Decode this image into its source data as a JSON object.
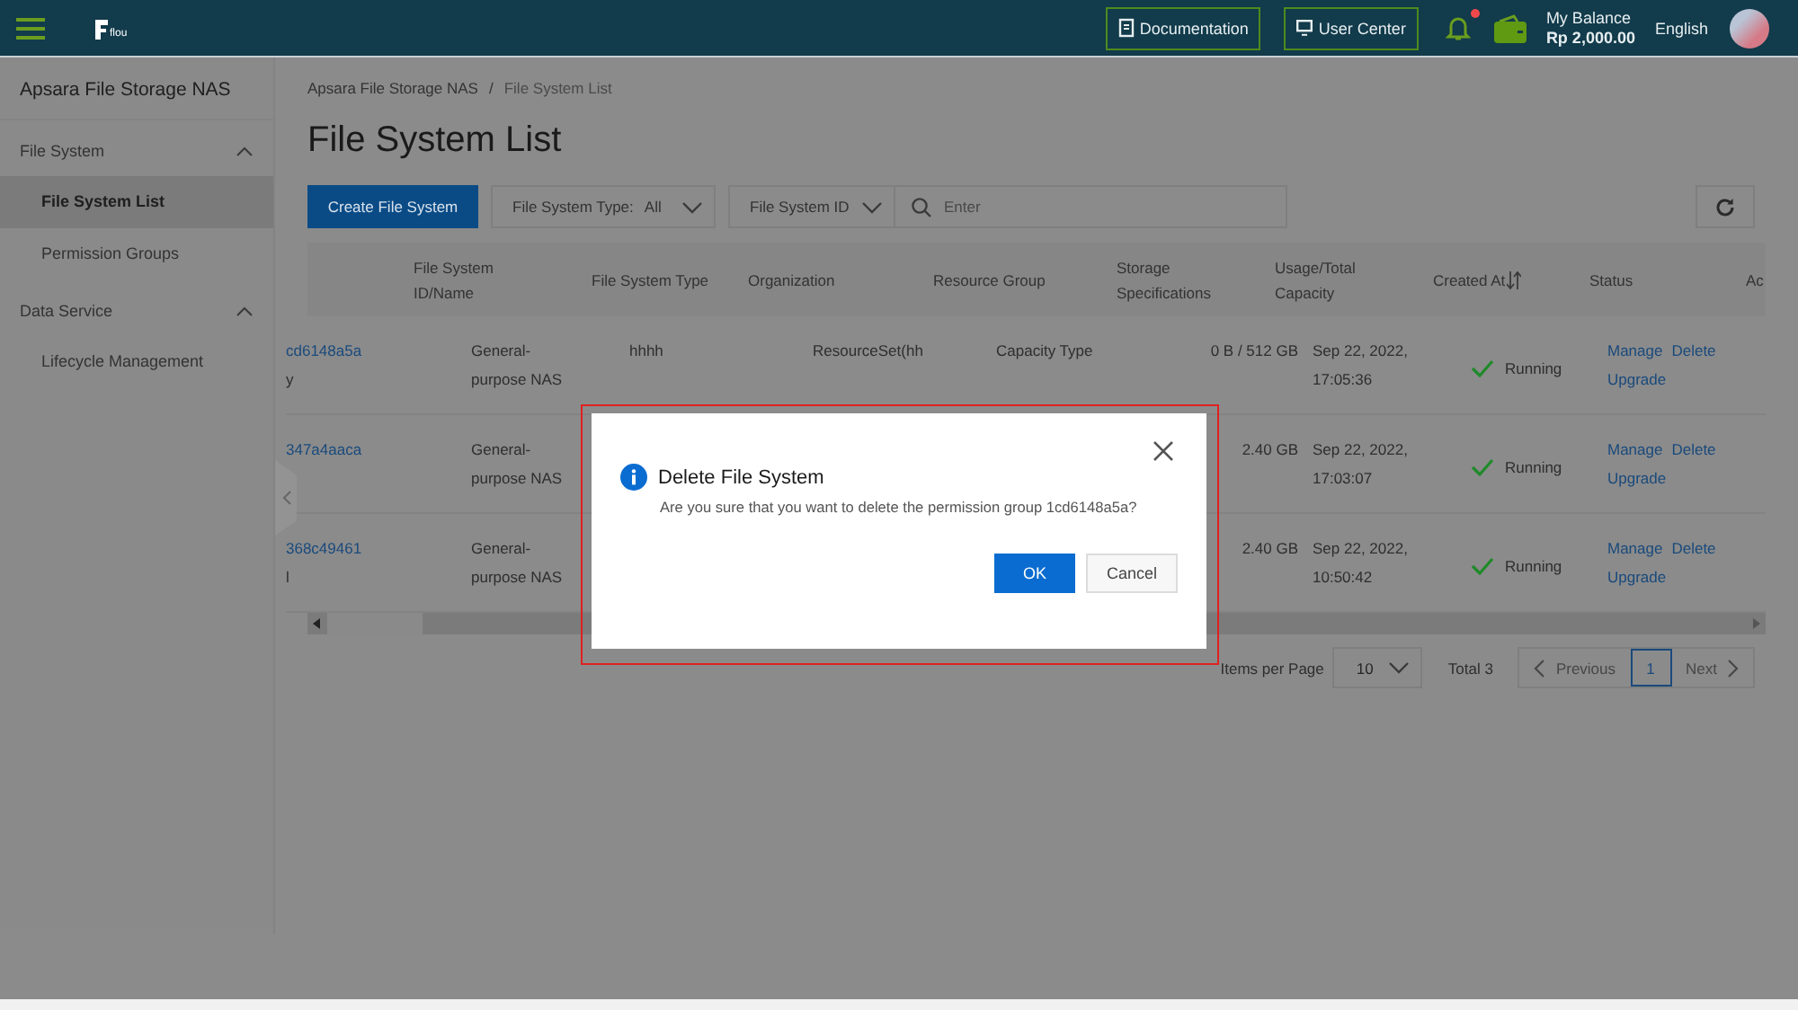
{
  "header": {
    "logo_text": "flou",
    "documentation": "Documentation",
    "user_center": "User Center",
    "notification_dot": true,
    "balance_label": "My Balance",
    "balance_value": "Rp 2,000.00",
    "language": "English"
  },
  "sidebar": {
    "title": "Apsara File Storage NAS",
    "groups": [
      {
        "label": "File System",
        "expanded": true,
        "items": [
          {
            "label": "File System List",
            "selected": true
          },
          {
            "label": "Permission Groups",
            "selected": false
          }
        ]
      },
      {
        "label": "Data Service",
        "expanded": true,
        "items": [
          {
            "label": "Lifecycle Management",
            "selected": false
          }
        ]
      }
    ]
  },
  "breadcrumb": [
    "Apsara File Storage NAS",
    "File System List"
  ],
  "breadcrumb_separator": "/",
  "page_title": "File System List",
  "toolbar": {
    "create_button": "Create File System",
    "type_filter": {
      "label": "File System Type:",
      "value": "All"
    },
    "field_select": "File System ID",
    "search": {
      "placeholder": "Enter"
    }
  },
  "table": {
    "columns": [
      "File System ID/Name",
      "File System Type",
      "Organization",
      "Resource Group",
      "Storage Specifications",
      "Usage/Total Capacity",
      "Created At",
      "Status",
      "Ac"
    ],
    "rows": [
      {
        "id": "cd6148a5a",
        "name": "y",
        "type": "General-purpose NAS",
        "organization": "hhhh",
        "resource_group": "ResourceSet(hh",
        "storage": "Capacity Type",
        "usage": "0 B / 512 GB",
        "created": "Sep 22, 2022, 17:05:36",
        "status": "Running",
        "actions": [
          "Manage",
          "Delete",
          "Upgrade"
        ]
      },
      {
        "id": "347a4aaca",
        "type": "General-purpose NAS",
        "usage": "2.40 GB",
        "created": "Sep 22, 2022, 17:03:07",
        "status": "Running",
        "actions": [
          "Manage",
          "Delete",
          "Upgrade"
        ]
      },
      {
        "id": "368c49461",
        "name": "l",
        "type": "General-purpose NAS",
        "usage": "2.40 GB",
        "created": "Sep 22, 2022, 10:50:42",
        "status": "Running",
        "actions": [
          "Manage",
          "Delete",
          "Upgrade"
        ]
      }
    ]
  },
  "pagination": {
    "items_label": "Items per Page",
    "page_size": "10",
    "total": "Total 3",
    "previous": {
      "label": "Previous",
      "disabled": true
    },
    "pages": [
      {
        "label": "1",
        "selected": true
      }
    ],
    "next": {
      "label": "Next",
      "disabled": true
    }
  },
  "dialog": {
    "title": "Delete File System",
    "message": "Are you sure that you want to delete the permission group 1cd6148a5a?",
    "ok": "OK",
    "cancel": "Cancel",
    "highlighted": true
  }
}
